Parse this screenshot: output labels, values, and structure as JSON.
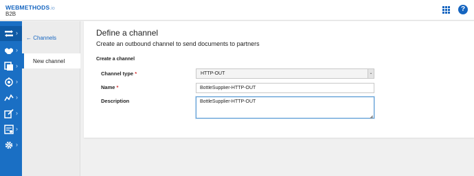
{
  "header": {
    "brand_name": "WEBMETHODS",
    "brand_suffix": ".io",
    "brand_sub": "B2B",
    "apps_icon": "apps-grid-icon",
    "help_icon": "help-icon",
    "help_glyph": "?"
  },
  "rail": {
    "accent": "#1a6fc4",
    "items": [
      {
        "icon": "channels-icon",
        "chevron": "›"
      },
      {
        "icon": "handshake-icon",
        "chevron": "›"
      },
      {
        "icon": "documents-icon",
        "chevron": "›"
      },
      {
        "icon": "target-icon",
        "chevron": "›"
      },
      {
        "icon": "analytics-icon",
        "chevron": "›"
      },
      {
        "icon": "edit-icon",
        "chevron": "›"
      },
      {
        "icon": "report-icon",
        "chevron": "›"
      },
      {
        "icon": "settings-icon",
        "chevron": "›"
      }
    ]
  },
  "subnav": {
    "back_label": "← Channels",
    "active_item": "New channel"
  },
  "page": {
    "title": "Define a channel",
    "subtitle": "Create an outbound channel to send documents to partners",
    "section": "Create a channel"
  },
  "form": {
    "channel_type_label": "Channel type",
    "channel_type_value": "HTTP-OUT",
    "name_label": "Name",
    "name_value": "BottleSupplier-HTTP-OUT",
    "description_label": "Description",
    "description_value": "BottleSupplier-HTTP-OUT",
    "required_mark": "*"
  }
}
